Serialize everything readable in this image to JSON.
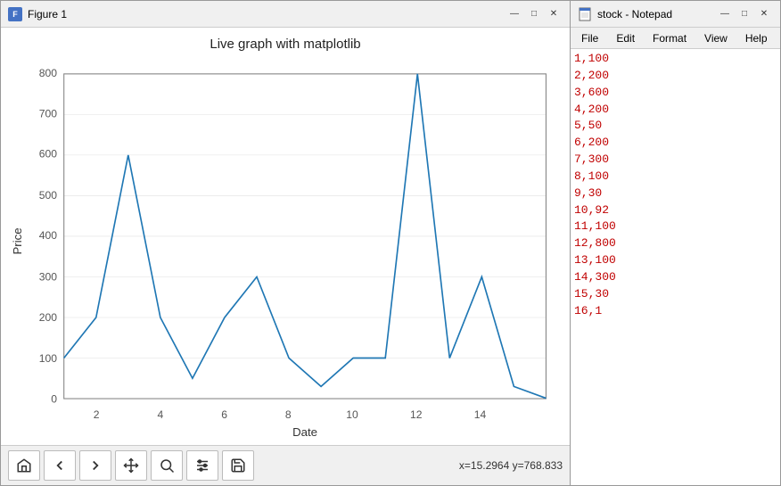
{
  "figure": {
    "title": "Figure 1",
    "chart_title": "Live graph with matplotlib",
    "x_label": "Date",
    "y_label": "Price",
    "toolbar": {
      "home_label": "🏠",
      "back_label": "←",
      "forward_label": "→",
      "pan_label": "✛",
      "zoom_label": "🔍",
      "adjust_label": "⚙",
      "save_label": "💾"
    },
    "coords": "x=15.2964     y=768.833",
    "window_controls": {
      "minimize": "—",
      "maximize": "□",
      "close": "✕"
    },
    "data_points": [
      {
        "x": 1,
        "y": 100
      },
      {
        "x": 2,
        "y": 200
      },
      {
        "x": 3,
        "y": 600
      },
      {
        "x": 4,
        "y": 200
      },
      {
        "x": 5,
        "y": 50
      },
      {
        "x": 6,
        "y": 200
      },
      {
        "x": 7,
        "y": 300
      },
      {
        "x": 8,
        "y": 100
      },
      {
        "x": 9,
        "y": 30
      },
      {
        "x": 10,
        "y": 100
      },
      {
        "x": 11,
        "y": 100
      },
      {
        "x": 12,
        "y": 800
      },
      {
        "x": 13,
        "y": 100
      },
      {
        "x": 14,
        "y": 300
      },
      {
        "x": 15,
        "y": 30
      },
      {
        "x": 16,
        "y": 1
      }
    ],
    "y_ticks": [
      0,
      100,
      200,
      300,
      400,
      500,
      600,
      700,
      800
    ],
    "x_ticks": [
      2,
      4,
      6,
      8,
      10,
      12,
      14
    ]
  },
  "notepad": {
    "title": "stock - Notepad",
    "menu": {
      "file": "File",
      "edit": "Edit",
      "format": "Format",
      "view": "View",
      "help": "Help"
    },
    "lines": [
      "1,100",
      "2,200",
      "3,600",
      "4,200",
      "5,50",
      "6,200",
      "7,300",
      "8,100",
      "9,30",
      "10,92",
      "11,100",
      "12,800",
      "13,100",
      "14,300",
      "15,30",
      "16,1"
    ]
  }
}
